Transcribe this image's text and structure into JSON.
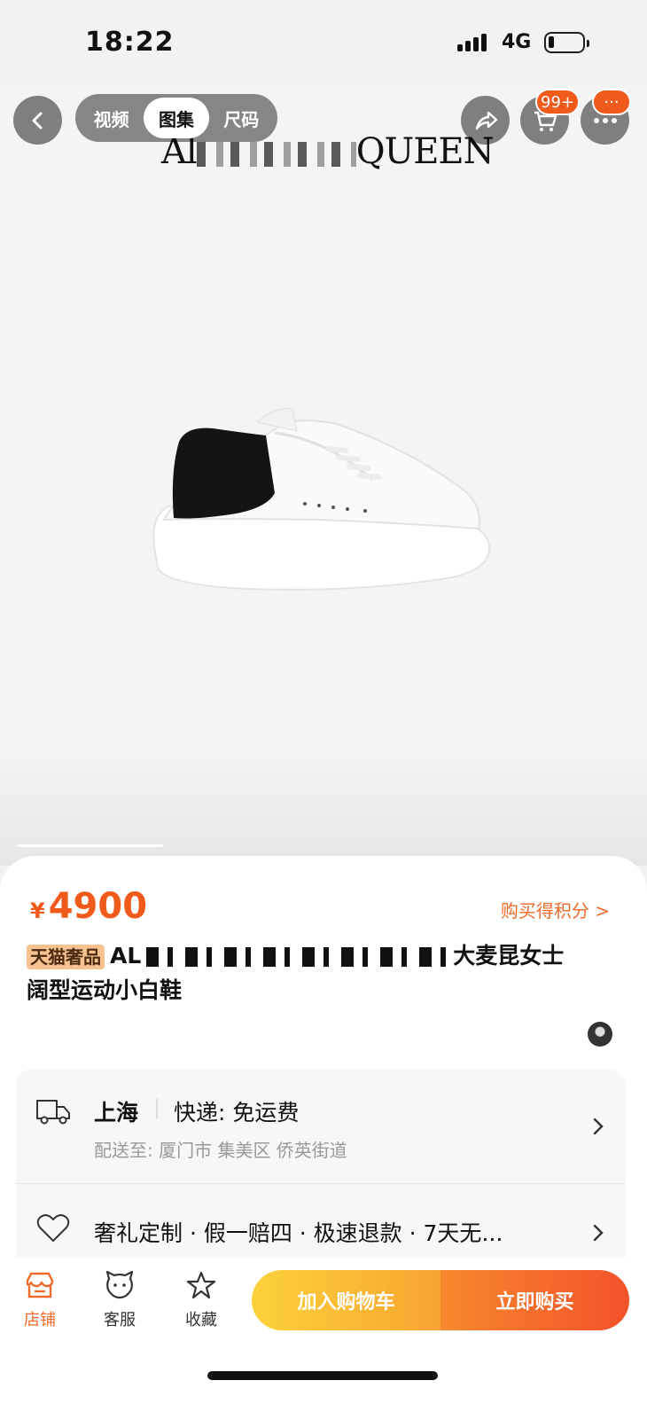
{
  "status_bar": {
    "time": "18:22",
    "network": "4G"
  },
  "hero": {
    "brand_text_left": "Al",
    "brand_text_right": "QUEEN",
    "tabs": [
      {
        "label": "视频"
      },
      {
        "label": "图集"
      },
      {
        "label": "尺码"
      }
    ],
    "active_tab": "图集",
    "cart_badge": "99+",
    "more_badge": "···"
  },
  "product": {
    "price_symbol": "¥",
    "price": "4900",
    "points_link": "购买得积分",
    "points_chevron": ">",
    "tag": "天猫奢品",
    "title_start": "AL",
    "title_end": "大麦昆女士",
    "title_line2": "阔型运动小白鞋"
  },
  "shipping": {
    "origin": "上海",
    "method": "快递: 免运费",
    "deliver_to": "配送至: 厦门市 集美区 侨英街道"
  },
  "services": {
    "text": "奢礼定制 · 假一赔四 · 极速退款 · 7天无..."
  },
  "bottom_nav": {
    "store": "店铺",
    "service": "客服",
    "favorite": "收藏",
    "add_cart": "加入购物车",
    "buy_now": "立即购买"
  },
  "colors": {
    "accent": "#f05a1a",
    "cta_yellow": "#fcd13a",
    "cta_orange": "#f3522a"
  }
}
